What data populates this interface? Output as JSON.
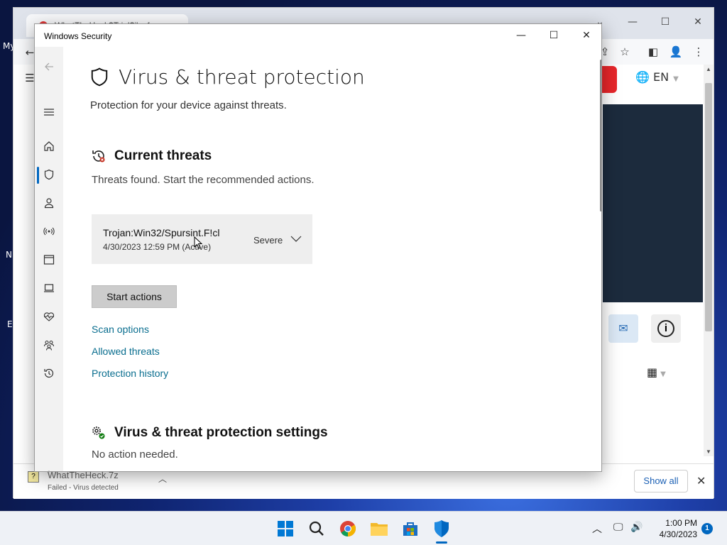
{
  "window": {
    "title": "Windows Security",
    "minimize": "—",
    "maximize": "☐",
    "close": "✕"
  },
  "sidebar": {
    "items": [
      {
        "icon": "back-arrow-icon"
      },
      {
        "icon": "hamburger-menu-icon"
      },
      {
        "icon": "home-icon"
      },
      {
        "icon": "shield-icon",
        "active": true
      },
      {
        "icon": "account-icon"
      },
      {
        "icon": "firewall-network-icon"
      },
      {
        "icon": "app-browser-control-icon"
      },
      {
        "icon": "device-security-icon"
      },
      {
        "icon": "device-performance-icon"
      },
      {
        "icon": "family-options-icon"
      },
      {
        "icon": "protection-history-icon"
      },
      {
        "icon": "settings-gear-icon"
      }
    ]
  },
  "main": {
    "title": "Virus & threat protection",
    "subtitle": "Protection for your device against threats.",
    "current_threats": {
      "heading": "Current threats",
      "description": "Threats found. Start the recommended actions.",
      "threat": {
        "name": "Trojan:Win32/Spursint.F!cl",
        "date": "4/30/2023 12:59 PM (Active)",
        "severity": "Severe"
      },
      "start_button": "Start actions",
      "links": [
        "Scan options",
        "Allowed threats",
        "Protection history"
      ]
    },
    "settings": {
      "heading": "Virus & threat protection settings",
      "description": "No action needed."
    }
  },
  "browser": {
    "tab_title": "WhatTheHack?Trial?ilesf...",
    "lang": "EN",
    "download": {
      "name": "WhatTheHeck.7z",
      "status": "Failed - Virus detected"
    },
    "show_all": "Show all"
  },
  "desktop": {
    "icon_labels": [
      "My",
      "N",
      "E"
    ]
  },
  "taskbar": {
    "time": "1:00 PM",
    "date": "4/30/2023",
    "notifications": "1",
    "colors": {
      "accent": "#0067c0"
    }
  }
}
